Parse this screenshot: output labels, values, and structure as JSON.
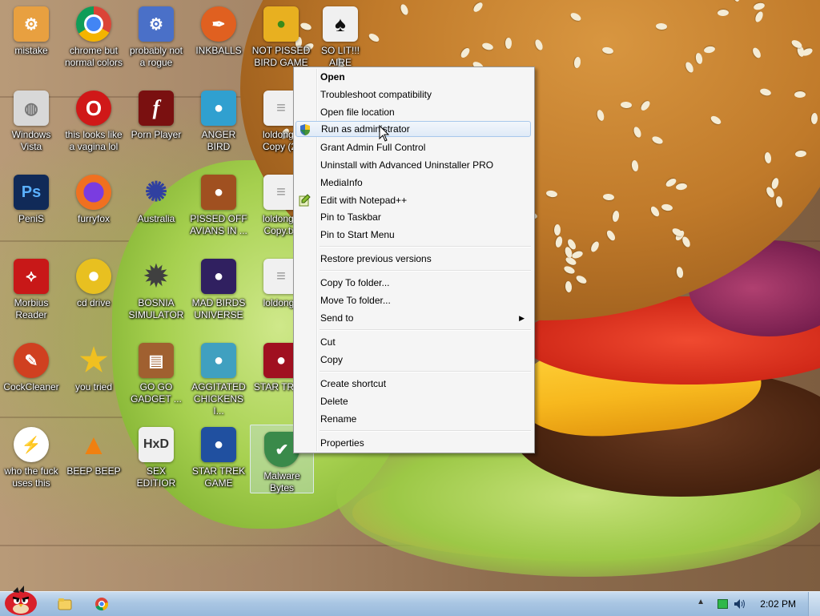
{
  "desktop": {
    "icons": [
      {
        "label": "mistake",
        "color": "#e8a040"
      },
      {
        "label": "chrome but normal colors",
        "color": "#3a8a3a"
      },
      {
        "label": "probably not a rogue",
        "color": "#4a70c8"
      },
      {
        "label": "INKBALLS",
        "color": "#e06020"
      },
      {
        "label": "NOT PISSED BIRD GAME",
        "color": "#e8b020"
      },
      {
        "label": "SO LIT!!! AIRE",
        "color": "#f0f0f0"
      },
      {
        "label": "Windows Vista",
        "color": "#d8d8d8"
      },
      {
        "label": "this looks like a vagina lol",
        "color": "#d01818"
      },
      {
        "label": "Porn Player",
        "color": "#7a1010"
      },
      {
        "label": "ANGER BIRD",
        "color": "#30a0d0"
      },
      {
        "label": "loldong - Copy (2)",
        "color": "#e8e8e8"
      },
      {
        "label": "PeniS",
        "color": "#102a58"
      },
      {
        "label": "furryfox",
        "color": "#f07020"
      },
      {
        "label": "Australia",
        "color": "#3040a0"
      },
      {
        "label": "PISSED OFF AVIANS IN ...",
        "color": "#a05020"
      },
      {
        "label": "loldong - Copy.txt",
        "color": "#e8e8e8"
      },
      {
        "label": "Morbius Reader",
        "color": "#c81818"
      },
      {
        "label": "cd drive",
        "color": "#e8c020"
      },
      {
        "label": "BOSNIA SIMULATOR",
        "color": "#606060"
      },
      {
        "label": "MAD BIRDS UNIVERSE",
        "color": "#302060"
      },
      {
        "label": "loldongs",
        "color": "#e8e8e8"
      },
      {
        "label": "CockCleaner",
        "color": "#d04020"
      },
      {
        "label": "you tried",
        "color": "#f0c020"
      },
      {
        "label": "GO GO GADGET ...",
        "color": "#a06030"
      },
      {
        "label": "AGGITATED CHICKENS I...",
        "color": "#40a0c0"
      },
      {
        "label": "STAR TRE...",
        "color": "#a01020"
      },
      {
        "label": "who the fuck uses this",
        "color": "#f06010"
      },
      {
        "label": "BEEP BEEP",
        "color": "#f08010"
      },
      {
        "label": "SEX EDITIOR",
        "color": "#f0f0f0"
      },
      {
        "label": "STAR TREK GAME",
        "color": "#2050a0"
      },
      {
        "label": "Malware Bytes",
        "color": "#3a8a4a"
      }
    ]
  },
  "context_menu": {
    "items": [
      {
        "label": "Open"
      },
      {
        "label": "Troubleshoot compatibility"
      },
      {
        "label": "Open file location"
      },
      {
        "label": "Run as administrator"
      },
      {
        "label": "Grant Admin Full Control"
      },
      {
        "label": "Uninstall with Advanced Uninstaller PRO"
      },
      {
        "label": "MediaInfo"
      },
      {
        "label": "Edit with Notepad++"
      },
      {
        "label": "Pin to Taskbar"
      },
      {
        "label": "Pin to Start Menu"
      },
      {
        "label": "Restore previous versions"
      },
      {
        "label": "Copy To folder..."
      },
      {
        "label": "Move To folder..."
      },
      {
        "label": "Send to"
      },
      {
        "label": "Cut"
      },
      {
        "label": "Copy"
      },
      {
        "label": "Create shortcut"
      },
      {
        "label": "Delete"
      },
      {
        "label": "Rename"
      },
      {
        "label": "Properties"
      }
    ],
    "highlighted": "Run as administrator",
    "submenu_arrow": "▶"
  },
  "taskbar": {
    "clock": "2:02 PM"
  },
  "colors": {
    "menu_bg": "#f5f5f5",
    "taskbar": "#a9c6e3",
    "highlight_border": "#a8c8ec"
  }
}
